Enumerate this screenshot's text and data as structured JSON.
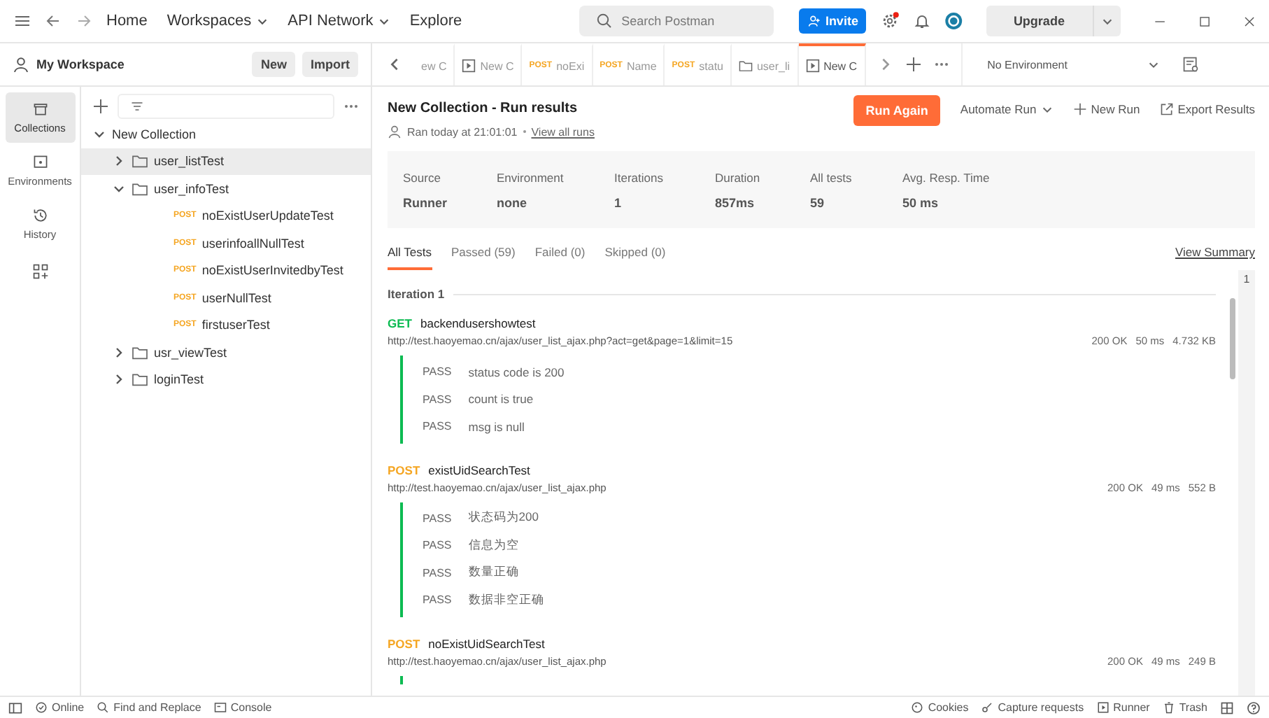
{
  "topbar": {
    "nav": [
      {
        "label": "Home",
        "dropdown": false
      },
      {
        "label": "Workspaces",
        "dropdown": true
      },
      {
        "label": "API Network",
        "dropdown": true
      },
      {
        "label": "Explore",
        "dropdown": false
      }
    ],
    "search": {
      "placeholder": "Search Postman"
    },
    "invite": "Invite",
    "upgrade": "Upgrade",
    "settings_alert": true
  },
  "workspace": {
    "title": "My Workspace",
    "buttons": [
      "New",
      "Import"
    ]
  },
  "rail": [
    {
      "label": "Collections",
      "kind": "collections",
      "selected": true
    },
    {
      "label": "Environments",
      "kind": "environments",
      "selected": false
    },
    {
      "label": "History",
      "kind": "history",
      "selected": false
    }
  ],
  "tree": [
    {
      "label": "New Collection",
      "kind": "collection",
      "expanded": true,
      "selected": false,
      "children": [
        {
          "label": "user_listTest",
          "kind": "folder",
          "expanded": false,
          "selected": true
        },
        {
          "label": "user_infoTest",
          "kind": "folder",
          "expanded": true,
          "selected": false,
          "children": [
            {
              "label": "noExistUserUpdateTest",
              "kind": "request",
              "method": "POST",
              "selected": false
            },
            {
              "label": "userinfoallNullTest",
              "kind": "request",
              "method": "POST",
              "selected": false
            },
            {
              "label": "noExistUserInvitedbyTest",
              "kind": "request",
              "method": "POST",
              "selected": false
            },
            {
              "label": "userNullTest",
              "kind": "request",
              "method": "POST",
              "selected": false
            },
            {
              "label": "firstuserTest",
              "kind": "request",
              "method": "POST",
              "selected": false
            }
          ]
        },
        {
          "label": "usr_viewTest",
          "kind": "folder",
          "expanded": false,
          "selected": false
        },
        {
          "label": "loginTest",
          "kind": "folder",
          "expanded": false,
          "selected": false
        }
      ]
    }
  ],
  "tabs": [
    {
      "kind": "plain",
      "label": "ew C",
      "selected": false
    },
    {
      "kind": "runner",
      "label": "New C",
      "selected": false
    },
    {
      "kind": "request",
      "method": "POST",
      "label": "noExi",
      "selected": false
    },
    {
      "kind": "request",
      "method": "POST",
      "label": "Name",
      "selected": false
    },
    {
      "kind": "request",
      "method": "POST",
      "label": "statu",
      "selected": false
    },
    {
      "kind": "folder",
      "label": "user_li",
      "selected": false
    },
    {
      "kind": "runner",
      "label": "New C",
      "selected": true
    }
  ],
  "environment": "No Environment",
  "run": {
    "title": "New Collection - Run results",
    "ran": "Ran today at 21:01:01",
    "view_all": "View all runs",
    "run_again": "Run Again",
    "automate": "Automate Run",
    "new_run": "New Run",
    "export": "Export Results",
    "stats": [
      {
        "label": "Source",
        "value": "Runner"
      },
      {
        "label": "Environment",
        "value": "none"
      },
      {
        "label": "Iterations",
        "value": "1"
      },
      {
        "label": "Duration",
        "value": "857ms"
      },
      {
        "label": "All tests",
        "value": "59"
      },
      {
        "label": "Avg. Resp. Time",
        "value": "50 ms"
      }
    ],
    "filters": [
      {
        "label": "All Tests",
        "selected": true
      },
      {
        "label": "Passed (59)",
        "selected": false
      },
      {
        "label": "Failed (0)",
        "selected": false
      },
      {
        "label": "Skipped (0)",
        "selected": false
      }
    ],
    "view_summary": "View Summary",
    "iteration": "Iteration 1",
    "marker": "1",
    "requests": [
      {
        "method": "GET",
        "name": "backendusershowtest",
        "url": "http://test.haoyemao.cn/ajax/user_list_ajax.php?act=get&page=1&limit=15",
        "status": "200 OK",
        "time": "50 ms",
        "size": "4.732 KB",
        "tests": [
          {
            "result": "PASS",
            "name": "status code is 200"
          },
          {
            "result": "PASS",
            "name": "count is true"
          },
          {
            "result": "PASS",
            "name": "msg is null"
          }
        ]
      },
      {
        "method": "POST",
        "name": "existUidSearchTest",
        "url": "http://test.haoyemao.cn/ajax/user_list_ajax.php",
        "status": "200 OK",
        "time": "49 ms",
        "size": "552 B",
        "tests": [
          {
            "result": "PASS",
            "name": "状态码为200"
          },
          {
            "result": "PASS",
            "name": "信息为空"
          },
          {
            "result": "PASS",
            "name": "数量正确"
          },
          {
            "result": "PASS",
            "name": "数据非空正确"
          }
        ]
      },
      {
        "method": "POST",
        "name": "noExistUidSearchTest",
        "url": "http://test.haoyemao.cn/ajax/user_list_ajax.php",
        "status": "200 OK",
        "time": "49 ms",
        "size": "249 B"
      }
    ]
  },
  "statusbar": {
    "left": [
      {
        "kind": "online",
        "label": "Online"
      },
      {
        "kind": "find",
        "label": "Find and Replace"
      },
      {
        "kind": "console",
        "label": "Console"
      }
    ],
    "right": [
      {
        "kind": "cookies",
        "label": "Cookies"
      },
      {
        "kind": "capture",
        "label": "Capture requests"
      },
      {
        "kind": "runner",
        "label": "Runner"
      },
      {
        "kind": "trash",
        "label": "Trash"
      }
    ]
  }
}
